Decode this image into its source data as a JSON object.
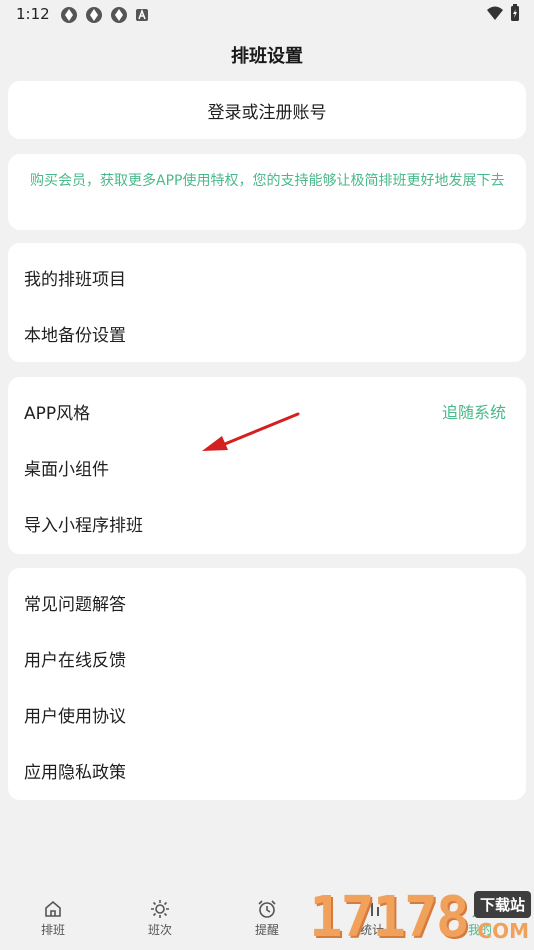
{
  "status": {
    "time": "1:12"
  },
  "header": {
    "title": "排班设置"
  },
  "login": {
    "label": "登录或注册账号"
  },
  "promo": {
    "text": "购买会员，获取更多APP使用特权，您的支持能够让极简排班更好地发展下去"
  },
  "groups": {
    "a": [
      {
        "label": "我的排班项目"
      },
      {
        "label": "本地备份设置"
      }
    ],
    "b": [
      {
        "label": "APP风格",
        "value": "追随系统"
      },
      {
        "label": "桌面小组件"
      },
      {
        "label": "导入小程序排班"
      }
    ],
    "c": [
      {
        "label": "常见问题解答"
      },
      {
        "label": "用户在线反馈"
      },
      {
        "label": "用户使用协议"
      },
      {
        "label": "应用隐私政策"
      }
    ]
  },
  "nav": [
    {
      "label": "排班",
      "icon": "home-icon"
    },
    {
      "label": "班次",
      "icon": "sun-icon"
    },
    {
      "label": "提醒",
      "icon": "alarm-icon"
    },
    {
      "label": "统计",
      "icon": "chart-icon"
    },
    {
      "label": "我的",
      "icon": "person-icon"
    }
  ],
  "watermark": {
    "digits": "17178",
    "label": "下载站",
    "domain": "COM"
  },
  "colors": {
    "accent": "#4ab98a",
    "background": "#f1f1f1",
    "arrow": "#d42020"
  }
}
